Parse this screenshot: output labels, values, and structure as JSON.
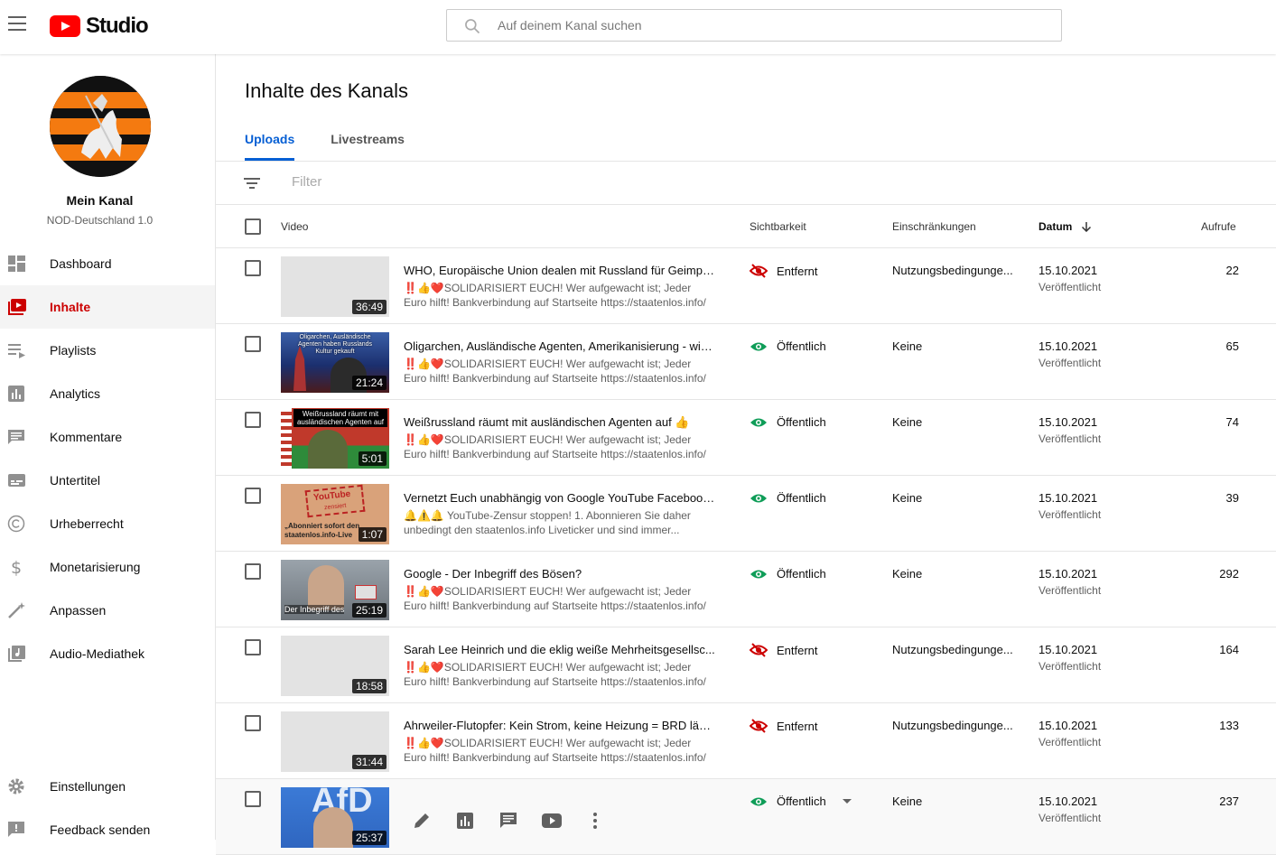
{
  "header": {
    "logo_text": "Studio",
    "search_placeholder": "Auf deinem Kanal suchen"
  },
  "sidebar": {
    "channel_title": "Mein Kanal",
    "channel_name": "NOD-Deutschland 1.0",
    "items": [
      {
        "label": "Dashboard",
        "icon": "dashboard-icon"
      },
      {
        "label": "Inhalte",
        "icon": "content-icon",
        "active": true
      },
      {
        "label": "Playlists",
        "icon": "playlist-icon"
      },
      {
        "label": "Analytics",
        "icon": "analytics-icon"
      },
      {
        "label": "Kommentare",
        "icon": "comments-icon"
      },
      {
        "label": "Untertitel",
        "icon": "subtitles-icon"
      },
      {
        "label": "Urheberrecht",
        "icon": "copyright-icon"
      },
      {
        "label": "Monetarisierung",
        "icon": "dollar-icon"
      },
      {
        "label": "Anpassen",
        "icon": "magic-wand-icon"
      },
      {
        "label": "Audio-Mediathek",
        "icon": "audio-library-icon"
      }
    ],
    "bottom": [
      {
        "label": "Einstellungen",
        "icon": "gear-icon"
      },
      {
        "label": "Feedback senden",
        "icon": "feedback-icon"
      }
    ]
  },
  "main": {
    "title": "Inhalte des Kanals",
    "tabs": [
      "Uploads",
      "Livestreams"
    ],
    "filter_placeholder": "Filter",
    "columns": {
      "video": "Video",
      "visibility": "Sichtbarkeit",
      "restrictions": "Einschränkungen",
      "date": "Datum",
      "views": "Aufrufe"
    },
    "rows": [
      {
        "title": "WHO, Europäische Union dealen mit Russland für Geimpft...",
        "desc": "‼️👍❤️SOLIDARISIERT EUCH! Wer aufgewacht ist; Jeder Euro hilft! Bankverbindung auf Startseite https://staatenlos.info/ ...",
        "duration": "36:49",
        "visibility": "Entfernt",
        "restrictions": "Nutzungsbedingunge...",
        "date": "15.10.2021",
        "date_status": "Veröffentlicht",
        "views": "22"
      },
      {
        "title": "Oligarchen, Ausländische Agenten, Amerikanisierung - wie...",
        "desc": "‼️👍❤️SOLIDARISIERT EUCH! Wer aufgewacht ist; Jeder Euro hilft! Bankverbindung auf Startseite https://staatenlos.info/ ...",
        "duration": "21:24",
        "visibility": "Öffentlich",
        "restrictions": "Keine",
        "date": "15.10.2021",
        "date_status": "Veröffentlicht",
        "views": "65"
      },
      {
        "title": "Weißrussland räumt mit ausländischen Agenten auf 👍",
        "desc": "‼️👍❤️SOLIDARISIERT EUCH! Wer aufgewacht ist; Jeder Euro hilft! Bankverbindung auf Startseite https://staatenlos.info/ ...",
        "duration": "5:01",
        "visibility": "Öffentlich",
        "restrictions": "Keine",
        "date": "15.10.2021",
        "date_status": "Veröffentlicht",
        "views": "74"
      },
      {
        "title": "Vernetzt Euch unabhängig von Google YouTube Facebook...",
        "desc": "🔔⚠️🔔 YouTube-Zensur stoppen! 1. Abonnieren Sie daher unbedingt den staatenlos.info Liveticker und sind immer...",
        "duration": "1:07",
        "visibility": "Öffentlich",
        "restrictions": "Keine",
        "date": "15.10.2021",
        "date_status": "Veröffentlicht",
        "views": "39"
      },
      {
        "title": "Google - Der Inbegriff des Bösen?",
        "desc": "‼️👍❤️SOLIDARISIERT EUCH! Wer aufgewacht ist; Jeder Euro hilft! Bankverbindung auf Startseite https://staatenlos.info/ ...",
        "duration": "25:19",
        "visibility": "Öffentlich",
        "restrictions": "Keine",
        "date": "15.10.2021",
        "date_status": "Veröffentlicht",
        "views": "292"
      },
      {
        "title": "Sarah Lee Heinrich und die eklig weiße Mehrheitsgesellsc...",
        "desc": "‼️👍❤️SOLIDARISIERT EUCH! Wer aufgewacht ist; Jeder Euro hilft! Bankverbindung auf Startseite https://staatenlos.info/ ...",
        "duration": "18:58",
        "visibility": "Entfernt",
        "restrictions": "Nutzungsbedingunge...",
        "date": "15.10.2021",
        "date_status": "Veröffentlicht",
        "views": "164"
      },
      {
        "title": "Ahrweiler-Flutopfer: Kein Strom, keine Heizung = BRD läss...",
        "desc": "‼️👍❤️SOLIDARISIERT EUCH! Wer aufgewacht ist; Jeder Euro hilft! Bankverbindung auf Startseite https://staatenlos.info/ ...",
        "duration": "31:44",
        "visibility": "Entfernt",
        "restrictions": "Nutzungsbedingunge...",
        "date": "15.10.2021",
        "date_status": "Veröffentlicht",
        "views": "133"
      },
      {
        "title": "",
        "desc": "",
        "duration": "25:37",
        "visibility": "Öffentlich",
        "restrictions": "Keine",
        "date": "15.10.2021",
        "date_status": "Veröffentlicht",
        "views": "237"
      }
    ],
    "thumb_texts": {
      "row2": "Oligarchen, Ausländische Agenten haben Russlands Kultur gekauft",
      "row3": "Weißrussland räumt mit ausländischen Agenten auf",
      "row4a": "YouTube",
      "row4b": "zensiert",
      "row4c": "„Abonniert sofort den staatenlos.info-Live",
      "row5": "Der Inbegriff des",
      "row8": "AfD"
    }
  },
  "colors": {
    "accent": "#065fd4",
    "active_red": "#cc0000",
    "public_green": "#0f9d58",
    "removed_red": "#cc0000"
  }
}
